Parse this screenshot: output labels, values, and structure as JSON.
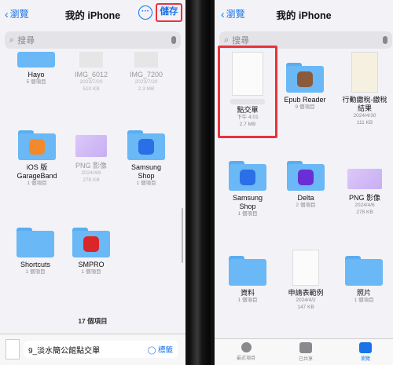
{
  "left": {
    "back_label": "瀏覽",
    "title": "我的 iPhone",
    "more_label": "···",
    "save_label": "儲存",
    "search_placeholder": "搜尋",
    "items": [
      {
        "name": "Hayo",
        "meta": "5 個項目"
      },
      {
        "name": "IMG_6012",
        "meta": "2023/7/20",
        "meta2": "510 KB"
      },
      {
        "name": "IMG_7200",
        "meta": "2023/7/20",
        "meta2": "2.3 MB"
      },
      {
        "name": "iOS 版",
        "name2": "GarageBand",
        "meta": "1 個項目"
      },
      {
        "name": "PNG 影像",
        "meta": "2024/4/6",
        "meta2": "278 KB"
      },
      {
        "name": "Samsung",
        "name2": "Shop",
        "meta": "1 個項目"
      },
      {
        "name": "Shortcuts",
        "meta": "1 個項目"
      },
      {
        "name": "SMPRO",
        "meta": "1 個項目"
      }
    ],
    "item_count": "17 個項目",
    "file_name": "9_淡水簡公館點交單",
    "tag_label": "◯ 標籤"
  },
  "right": {
    "back_label": "瀏覽",
    "title": "我的 iPhone",
    "search_placeholder": "搜尋",
    "items": [
      {
        "name": "點交單",
        "meta": "下午 4:01",
        "meta2": "2.7 MB"
      },
      {
        "name": "Epub Reader",
        "meta": "9 個項目"
      },
      {
        "name": "行動繳稅-繳稅",
        "name2": "結果",
        "meta": "2024/4/30",
        "meta2": "111 KB"
      },
      {
        "name": "Samsung",
        "name2": "Shop",
        "meta": "1 個項目"
      },
      {
        "name": "Delta",
        "meta": "2 個項目"
      },
      {
        "name": "PNG 影像",
        "meta": "2024/4/6",
        "meta2": "278 KB"
      },
      {
        "name": "資料",
        "meta": "1 個項目"
      },
      {
        "name": "申請表範例",
        "meta": "2024/4/2",
        "meta2": "147 KB"
      },
      {
        "name": "照片",
        "meta": "1 個項目"
      }
    ],
    "tabs": [
      {
        "label": "最近項目"
      },
      {
        "label": "已共享"
      },
      {
        "label": "瀏覽"
      }
    ]
  },
  "colors": {
    "accent": "#1a73e8",
    "highlight": "#e8333b",
    "folder": "#6ab8f5"
  }
}
